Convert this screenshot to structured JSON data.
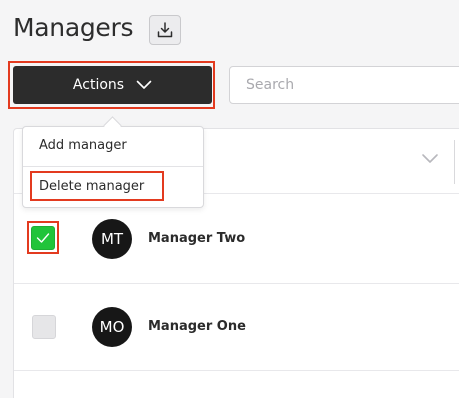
{
  "header": {
    "title": "Managers",
    "download_icon": "download-icon"
  },
  "toolbar": {
    "actions_label": "Actions",
    "actions_icon": "chevron-down-icon",
    "search_placeholder": "Search",
    "search_value": ""
  },
  "actions_menu": {
    "items": [
      {
        "label": "Add manager"
      },
      {
        "label": "Delete manager"
      }
    ]
  },
  "table": {
    "header_sort_icon": "chevron-down-icon",
    "rows": [
      {
        "initials": "MT",
        "name": "Manager Two",
        "selected": true
      },
      {
        "initials": "MO",
        "name": "Manager One",
        "selected": false
      }
    ]
  },
  "colors": {
    "highlight": "#e33a1f",
    "checkbox_checked": "#21c43a",
    "button_dark": "#2c2c2c",
    "avatar": "#171717"
  }
}
